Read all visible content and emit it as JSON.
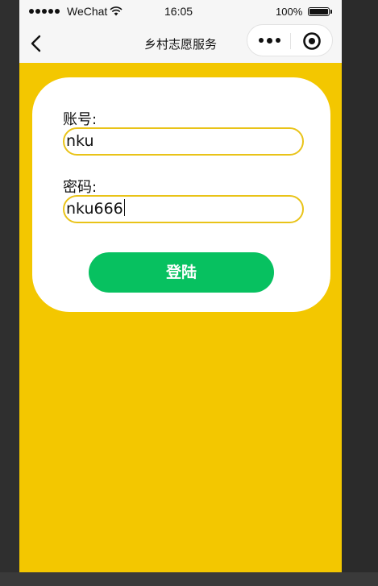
{
  "status_bar": {
    "carrier": "WeChat",
    "time": "16:05",
    "battery_percent": "100%",
    "battery_level": 1.0,
    "signal_icon": "signal-dots-icon",
    "wifi_icon": "wifi-icon",
    "battery_icon": "battery-icon"
  },
  "nav": {
    "title": "乡村志愿服务",
    "back_icon": "chevron-left-icon",
    "more_icon": "more-dots-icon",
    "close_icon": "mini-program-close-icon"
  },
  "form": {
    "account_label": "账号:",
    "account_value": "nku",
    "password_label": "密码:",
    "password_value": "nku666",
    "login_label": "登陆"
  },
  "colors": {
    "background": "#f3c700",
    "card": "#ffffff",
    "input_border": "#e9c318",
    "button": "#07c160",
    "button_text": "#ffffff"
  }
}
